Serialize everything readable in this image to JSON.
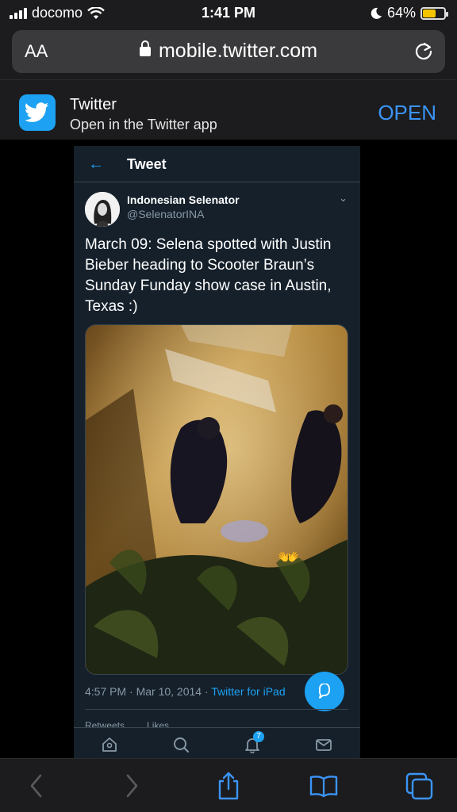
{
  "status_bar": {
    "carrier": "docomo",
    "time": "1:41 PM",
    "battery_percent": "64%",
    "battery_level": 0.64,
    "icons": [
      "signal-bars-icon",
      "wifi-icon",
      "moon-icon",
      "battery-icon"
    ]
  },
  "address_bar": {
    "text_size_label": "AA",
    "url": "mobile.twitter.com",
    "icons": [
      "lock-icon",
      "reload-icon"
    ]
  },
  "app_banner": {
    "app_name": "Twitter",
    "subtitle": "Open in the Twitter app",
    "open_label": "OPEN",
    "accent": "#3b94f5",
    "icon": "twitter-bird-icon"
  },
  "tweet_screen": {
    "header_title": "Tweet",
    "back_icon": "back-arrow-icon",
    "author_name": "Indonesian Selenator",
    "author_handle": "@SelenatorINA",
    "text": "March 09: Selena spotted with Justin Bieber heading to Scooter Braun’s Sunday Funday show case in Austin, Texas :)",
    "timestamp": "4:57 PM · Mar 10, 2014 · ",
    "source": "Twitter for iPad",
    "stats_retweets_label": "Retweets",
    "stats_likes_label": "Likes",
    "notification_badge": "7",
    "accent": "#1da1f2",
    "background": "#15202b",
    "tabs": [
      "home-icon",
      "search-icon",
      "notifications-bell-icon",
      "messages-icon"
    ]
  },
  "browser_toolbar": {
    "buttons": [
      "back-chevron-icon",
      "forward-chevron-icon",
      "share-icon",
      "bookmarks-icon",
      "tabs-icon"
    ]
  }
}
